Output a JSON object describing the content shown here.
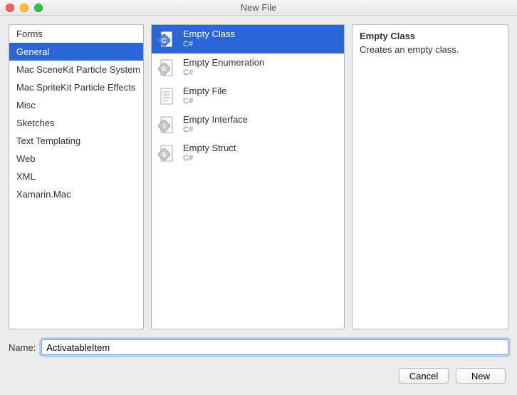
{
  "window": {
    "title": "New File"
  },
  "categories": [
    {
      "label": "Forms",
      "selected": false
    },
    {
      "label": "General",
      "selected": true
    },
    {
      "label": "Mac SceneKit Particle System",
      "selected": false
    },
    {
      "label": "Mac SpriteKit Particle Effects",
      "selected": false
    },
    {
      "label": "Misc",
      "selected": false
    },
    {
      "label": "Sketches",
      "selected": false
    },
    {
      "label": "Text Templating",
      "selected": false
    },
    {
      "label": "Web",
      "selected": false
    },
    {
      "label": "XML",
      "selected": false
    },
    {
      "label": "Xamarin.Mac",
      "selected": false
    }
  ],
  "templates": [
    {
      "label": "Empty Class",
      "sub": "C#",
      "icon": "C",
      "selected": true
    },
    {
      "label": "Empty Enumeration",
      "sub": "C#",
      "icon": "E",
      "selected": false
    },
    {
      "label": "Empty File",
      "sub": "C#",
      "icon": "file",
      "selected": false
    },
    {
      "label": "Empty Interface",
      "sub": "C#",
      "icon": "I",
      "selected": false
    },
    {
      "label": "Empty Struct",
      "sub": "C#",
      "icon": "S",
      "selected": false
    }
  ],
  "description": {
    "title": "Empty Class",
    "text": "Creates an empty class."
  },
  "nameRow": {
    "label": "Name:",
    "value": "ActivatableItem"
  },
  "buttons": {
    "cancel": "Cancel",
    "confirm": "New"
  }
}
